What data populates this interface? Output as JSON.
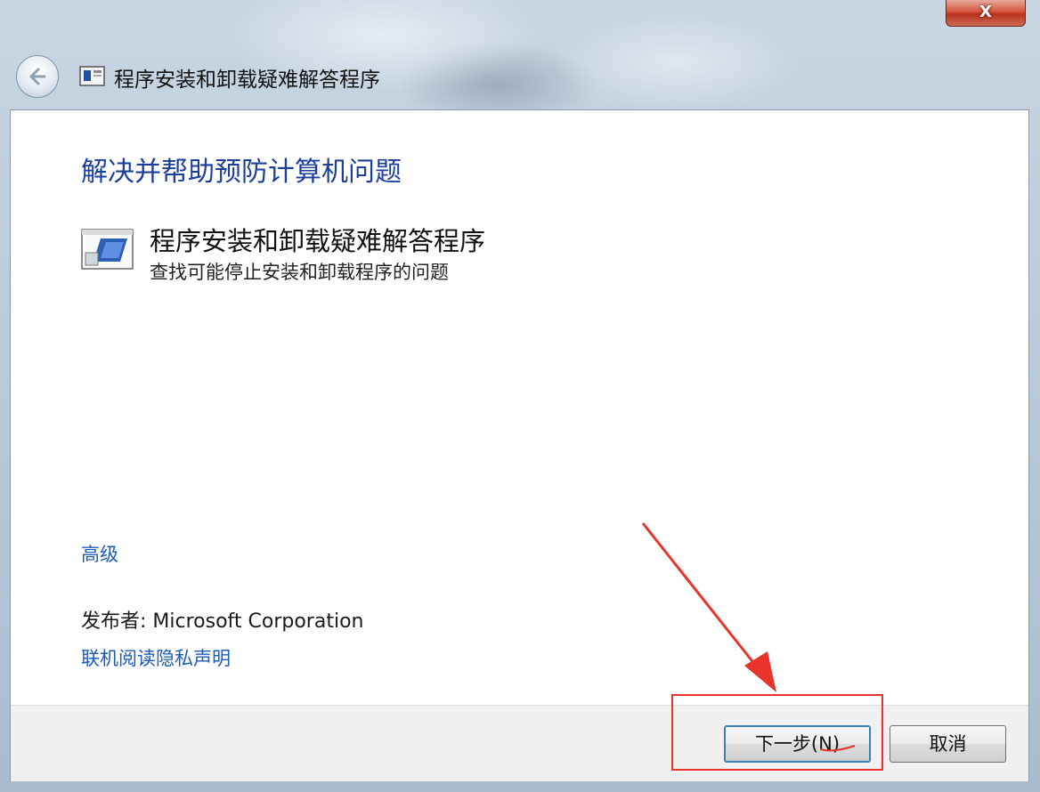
{
  "window": {
    "title": "程序安装和卸载疑难解答程序",
    "close_label": "X"
  },
  "main": {
    "heading": "解决并帮助预防计算机问题",
    "tool": {
      "title": "程序安装和卸载疑难解答程序",
      "description": "查找可能停止安装和卸载程序的问题"
    },
    "advanced_link": "高级",
    "publisher": "发布者: Microsoft Corporation",
    "privacy_link": "联机阅读隐私声明"
  },
  "footer": {
    "next_label": "下一步(N)",
    "cancel_label": "取消"
  },
  "icons": {
    "back": "back-arrow-icon",
    "app": "troubleshooter-icon"
  },
  "colors": {
    "link": "#1b5cb8",
    "heading": "#1b3f9a",
    "annotation": "#e8342b"
  }
}
